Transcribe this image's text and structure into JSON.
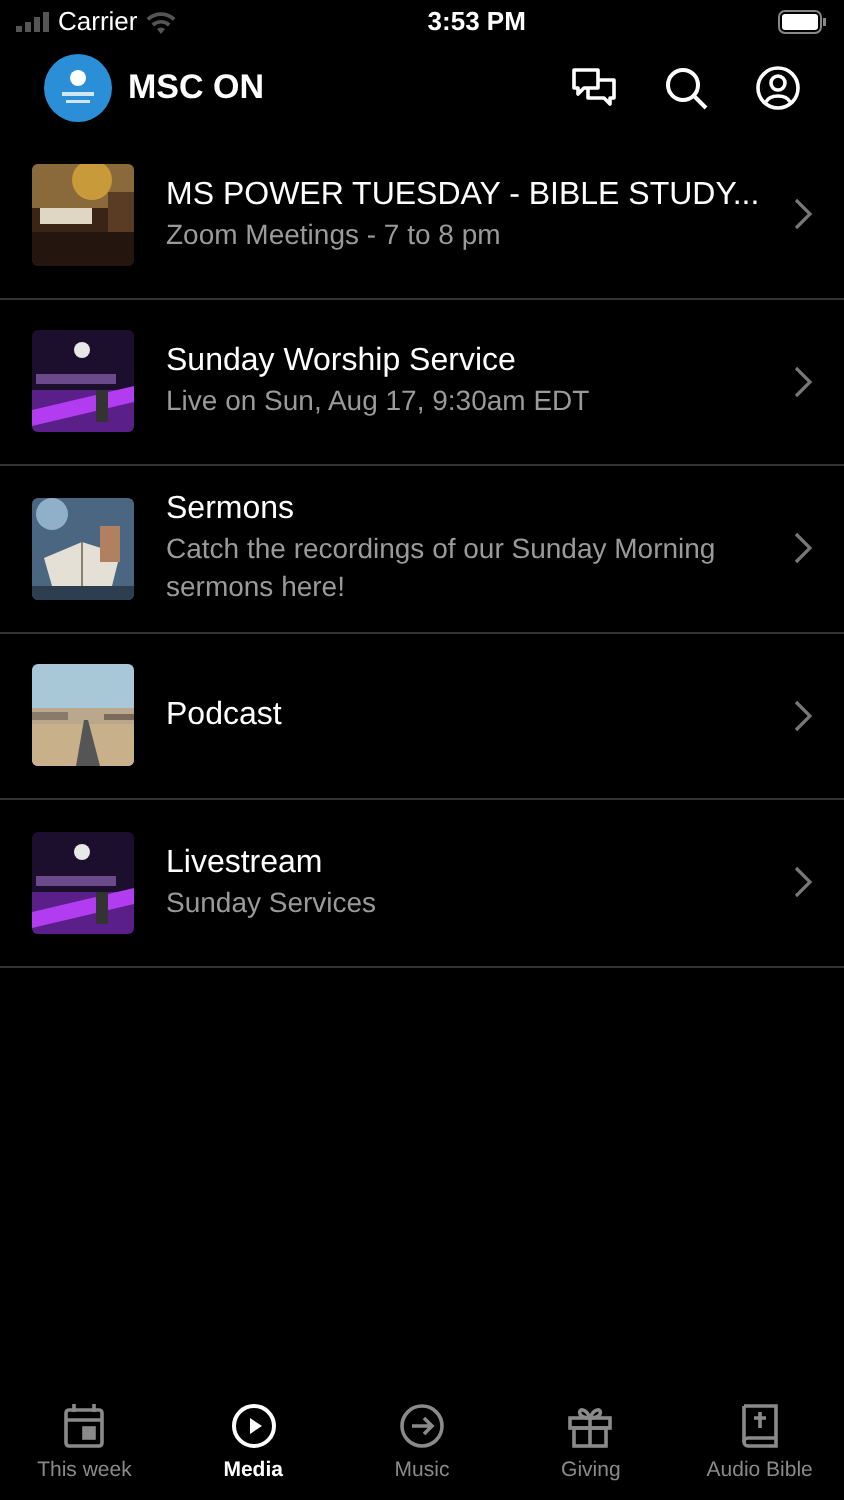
{
  "status_bar": {
    "carrier": "Carrier",
    "time": "3:53 PM"
  },
  "header": {
    "title": "MSC ON"
  },
  "items": [
    {
      "title": "MS POWER TUESDAY - BIBLE STUDY...",
      "subtitle": "Zoom Meetings - 7 to 8 pm"
    },
    {
      "title": "Sunday Worship Service",
      "subtitle": "Live on Sun, Aug 17, 9:30am EDT"
    },
    {
      "title": "Sermons",
      "subtitle": "Catch the recordings of our Sunday Morning sermons here!"
    },
    {
      "title": "Podcast"
    },
    {
      "title": "Livestream",
      "subtitle": "Sunday Services"
    }
  ],
  "tabs": [
    {
      "label": "This week",
      "kind": "calendar",
      "selected": false
    },
    {
      "label": "Media",
      "kind": "play",
      "selected": true
    },
    {
      "label": "Music",
      "kind": "arrow",
      "selected": false
    },
    {
      "label": "Giving",
      "kind": "gift",
      "selected": false
    },
    {
      "label": "Audio Bible",
      "kind": "bible",
      "selected": false
    }
  ]
}
